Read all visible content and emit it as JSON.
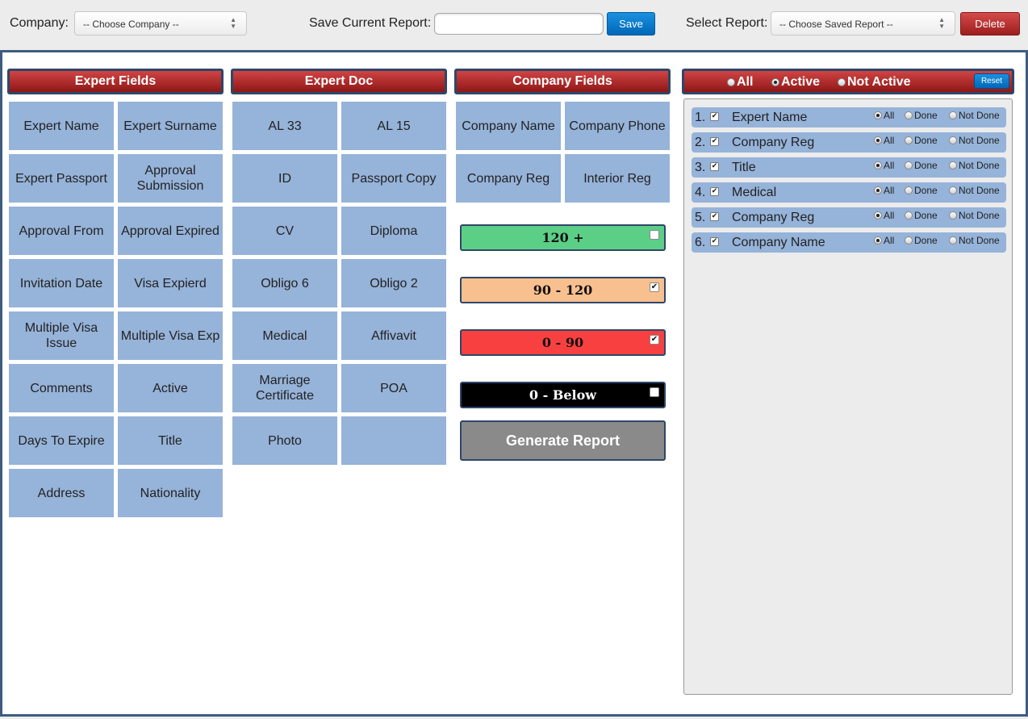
{
  "topbar": {
    "company_label": "Company:",
    "company_select": "-- Choose Company --",
    "save_report_label": "Save Current Report:",
    "save_report_value": "",
    "save_button": "Save",
    "select_report_label": "Select Report:",
    "report_select": "-- Choose Saved Report --",
    "delete_button": "Delete"
  },
  "expert_fields": {
    "title": "Expert Fields",
    "items": [
      "Expert Name",
      "Expert Surname",
      "Expert Passport",
      "Approval Submission",
      "Approval From",
      "Approval Expired",
      "Invitation Date",
      "Visa Expierd",
      "Multiple Visa Issue",
      "Multiple Visa Exp",
      "Comments",
      "Active",
      "Days To Expire",
      "Title",
      "Address",
      "Nationality"
    ]
  },
  "expert_doc": {
    "title": "Expert Doc",
    "items": [
      "AL 33",
      "AL 15",
      "ID",
      "Passport Copy",
      "CV",
      "Diploma",
      "Obligo 6",
      "Obligo 2",
      "Medical",
      "Affivavit",
      "Marriage Certificate",
      "POA",
      "Photo",
      ""
    ]
  },
  "company_fields": {
    "title": "Company Fields",
    "items": [
      "Company Name",
      "Company Phone",
      "Company Reg",
      "Interior Reg"
    ]
  },
  "ranges": [
    {
      "label": "120 +",
      "checked": false,
      "color": "#5ccf86",
      "text_color": "#111111"
    },
    {
      "label": "90 - 120",
      "checked": true,
      "color": "#f9c08f",
      "text_color": "#111111"
    },
    {
      "label": "0 - 90",
      "checked": true,
      "color": "#f94040",
      "text_color": "#111111"
    },
    {
      "label": "0 - Below",
      "checked": false,
      "color": "#000000",
      "text_color": "#ffffff"
    }
  ],
  "generate_button": "Generate Report",
  "filter": {
    "options": [
      "All",
      "Active",
      "Not Active"
    ],
    "selected": "Active",
    "reset_button": "Reset"
  },
  "selected_fields": {
    "status_options": [
      "All",
      "Done",
      "Not Done"
    ],
    "rows": [
      {
        "num": "1.",
        "label": "Expert Name",
        "checked": true,
        "status": "All"
      },
      {
        "num": "2.",
        "label": "Company Reg",
        "checked": true,
        "status": "All"
      },
      {
        "num": "3.",
        "label": "Title",
        "checked": true,
        "status": "All"
      },
      {
        "num": "4.",
        "label": "Medical",
        "checked": true,
        "status": "All"
      },
      {
        "num": "5.",
        "label": "Company Reg",
        "checked": true,
        "status": "All"
      },
      {
        "num": "6.",
        "label": "Company Name",
        "checked": true,
        "status": "All"
      }
    ]
  }
}
